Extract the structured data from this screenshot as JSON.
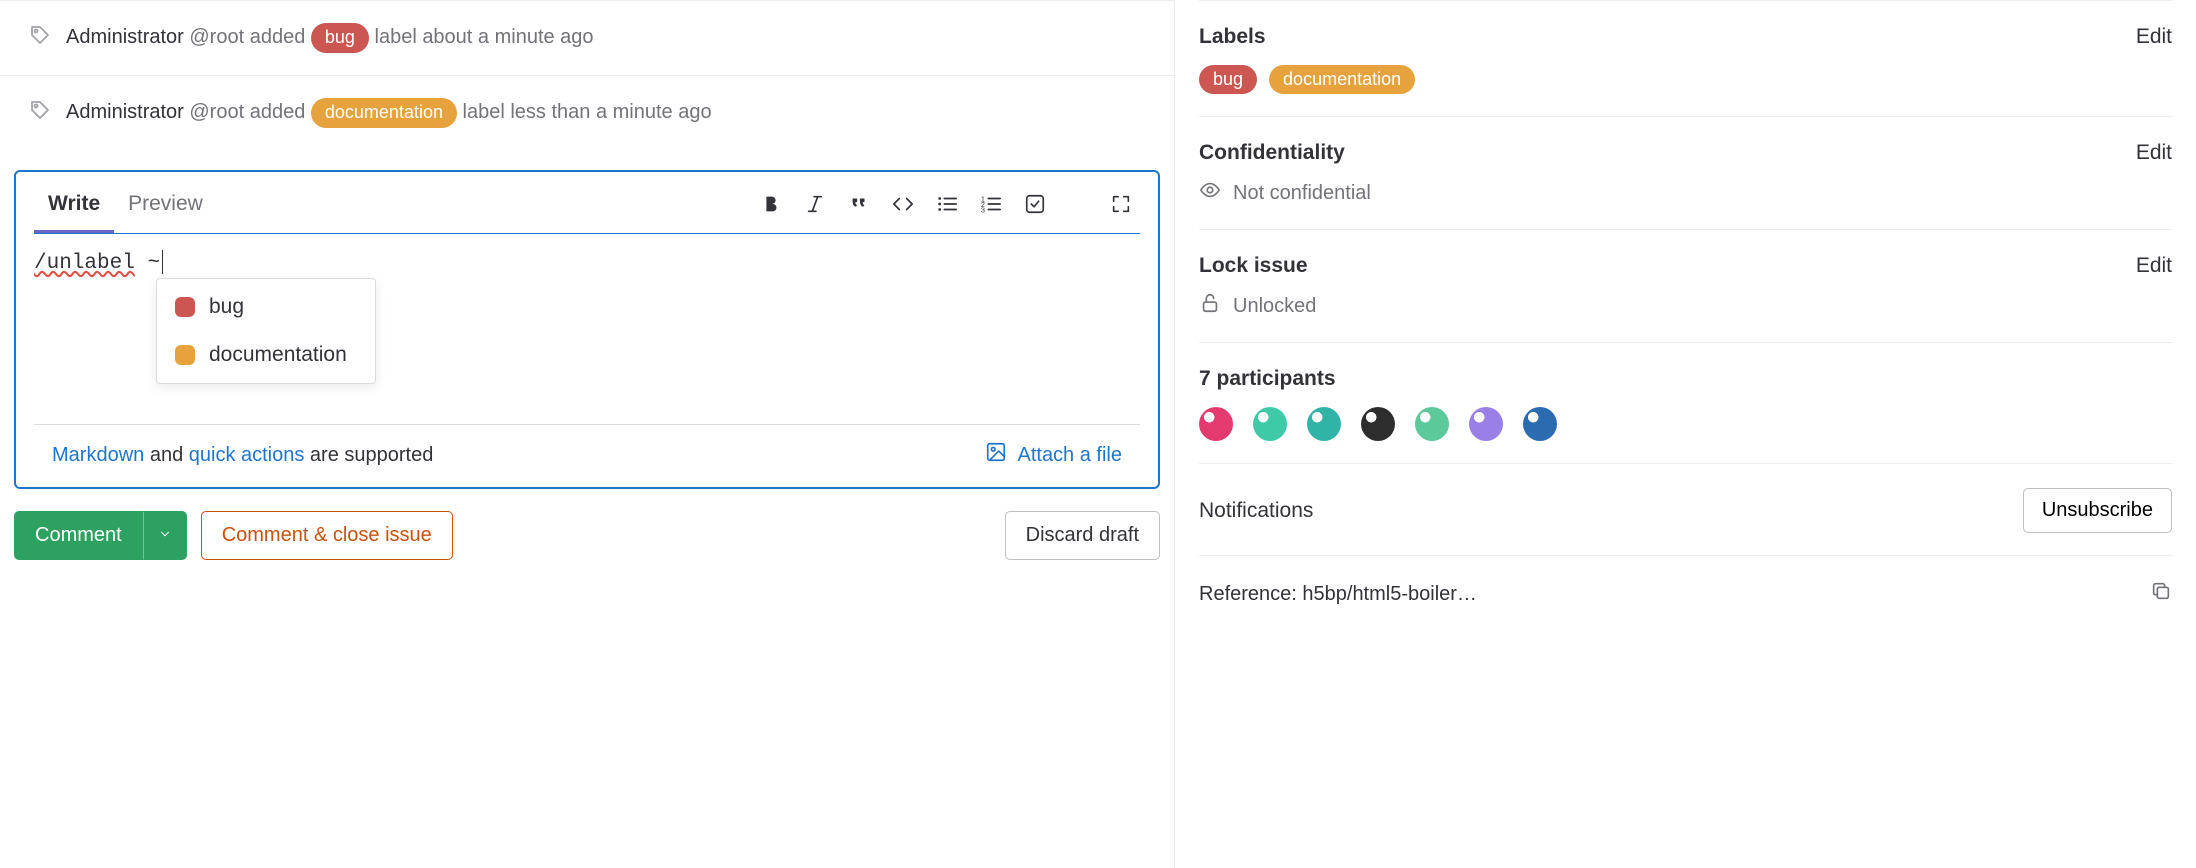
{
  "activity": [
    {
      "actor": "Administrator",
      "handle": "@root",
      "verb": "added",
      "label": "bug",
      "labelClass": "chip-bug",
      "suffix": "label about a minute ago"
    },
    {
      "actor": "Administrator",
      "handle": "@root",
      "verb": "added",
      "label": "documentation",
      "labelClass": "chip-doc",
      "suffix": "label less than a minute ago"
    }
  ],
  "editor": {
    "tabs": {
      "write": "Write",
      "preview": "Preview"
    },
    "typed_command": "/unlabel",
    "typed_trigger": "~",
    "autocomplete": [
      {
        "label": "bug",
        "swatchClass": "sw-bug"
      },
      {
        "label": "documentation",
        "swatchClass": "sw-doc"
      }
    ],
    "footer": {
      "markdown": "Markdown",
      "and": " and ",
      "quick_actions": "quick actions",
      "supported": " are supported",
      "attach": "Attach a file"
    }
  },
  "actions": {
    "comment": "Comment",
    "comment_close": "Comment & close issue",
    "discard": "Discard draft"
  },
  "sidebar": {
    "labels": {
      "title": "Labels",
      "edit": "Edit",
      "chips": [
        {
          "text": "bug",
          "class": "chip-bug"
        },
        {
          "text": "documentation",
          "class": "chip-doc"
        }
      ]
    },
    "confidentiality": {
      "title": "Confidentiality",
      "edit": "Edit",
      "value": "Not confidential"
    },
    "lock": {
      "title": "Lock issue",
      "edit": "Edit",
      "value": "Unlocked"
    },
    "participants": {
      "title": "7 participants",
      "avatars": [
        {
          "color1": "#e33a6f",
          "color2": "#fff"
        },
        {
          "color1": "#3ec9a7",
          "color2": "#fff"
        },
        {
          "color1": "#2fb4a6",
          "color2": "#fff"
        },
        {
          "color1": "#2d2d2d",
          "color2": "#fff"
        },
        {
          "color1": "#5cc99a",
          "color2": "#fff"
        },
        {
          "color1": "#9a7fe6",
          "color2": "#fff"
        },
        {
          "color1": "#2b6cb0",
          "color2": "#fff"
        }
      ]
    },
    "notifications": {
      "title": "Notifications",
      "button": "Unsubscribe"
    },
    "reference": {
      "text": "Reference: h5bp/html5-boiler…"
    }
  }
}
